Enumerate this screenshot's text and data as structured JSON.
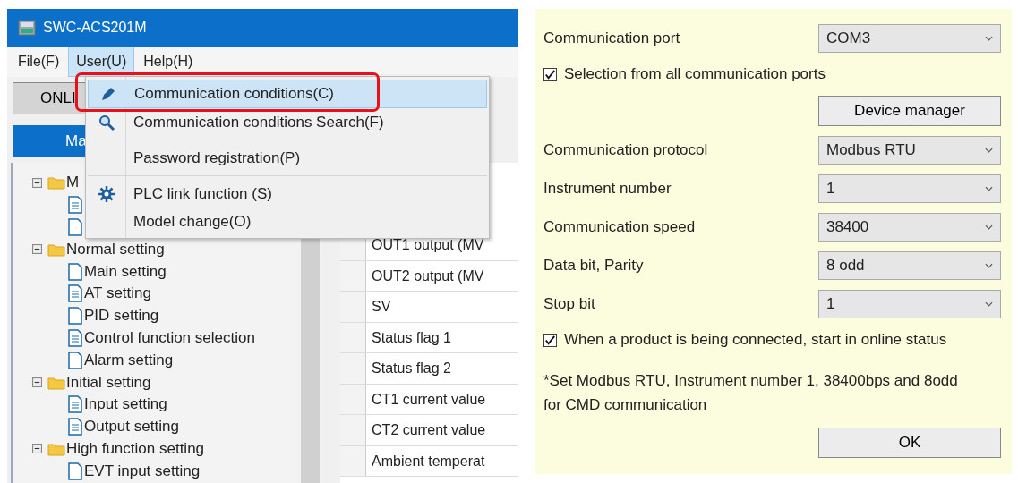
{
  "window": {
    "title": "SWC-ACS201M"
  },
  "menu_bar": [
    {
      "label": "File(F)",
      "selected": false
    },
    {
      "label": "User(U)",
      "selected": true
    },
    {
      "label": "Help(H)",
      "selected": false
    }
  ],
  "toolbar": {
    "button": "ONLI"
  },
  "tab": {
    "label": "Ma"
  },
  "tree": [
    {
      "label": "M",
      "expanded": true,
      "children": [
        {
          "kind": "lined"
        },
        {
          "kind": "plain"
        }
      ]
    },
    {
      "label": "Normal setting",
      "expanded": true,
      "children": [
        {
          "kind": "plain",
          "label": "Main setting"
        },
        {
          "kind": "lined",
          "label": "AT setting"
        },
        {
          "kind": "plain",
          "label": "PID setting"
        },
        {
          "kind": "lined",
          "label": "Control function selection"
        },
        {
          "kind": "plain",
          "label": "Alarm setting"
        }
      ]
    },
    {
      "label": "Initial setting",
      "expanded": true,
      "children": [
        {
          "kind": "lined",
          "label": "Input setting"
        },
        {
          "kind": "lined",
          "label": "Output setting"
        }
      ]
    },
    {
      "label": "High function setting",
      "expanded": true,
      "children": [
        {
          "kind": "plain",
          "label": "EVT input setting"
        }
      ]
    }
  ],
  "grid_rows": [
    "OUT1 output (MV",
    "OUT2 output (MV",
    "SV",
    "Status flag 1",
    "Status flag 2",
    "CT1 current value",
    "CT2 current value",
    "Ambient temperat"
  ],
  "user_menu": {
    "items": [
      {
        "label": "Communication conditions(C)",
        "kind": "pen",
        "selected": true,
        "annotated": true,
        "separator_before": false
      },
      {
        "label": "Communication conditions Search(F)",
        "kind": "search",
        "selected": false,
        "annotated": false,
        "separator_before": false
      },
      {
        "label": "Password registration(P)",
        "kind": "plain",
        "selected": false,
        "annotated": false,
        "separator_before": true
      },
      {
        "label": "PLC link function (S)",
        "kind": "gear",
        "selected": false,
        "annotated": false,
        "separator_before": true
      },
      {
        "label": "Model change(O)",
        "kind": "plain",
        "selected": false,
        "annotated": false,
        "separator_before": false
      }
    ]
  },
  "dialog": {
    "fields": [
      {
        "kind": "select",
        "label": "Communication port",
        "value": "COM3"
      },
      {
        "kind": "checkbox",
        "label": "Selection from all communication ports",
        "checked": true
      },
      {
        "kind": "button",
        "label": "Device manager"
      },
      {
        "kind": "select",
        "label": "Communication protocol",
        "value": "Modbus RTU"
      },
      {
        "kind": "select",
        "label": "Instrument number",
        "value": "1"
      },
      {
        "kind": "select",
        "label": "Communication speed",
        "value": "38400"
      },
      {
        "kind": "select",
        "label": "Data bit, Parity",
        "value": "8 odd"
      },
      {
        "kind": "select",
        "label": "Stop bit",
        "value": "1"
      },
      {
        "kind": "checkbox",
        "label": "When a product is being connected, start in online status",
        "checked": true
      },
      {
        "kind": "note",
        "label": "*Set Modbus RTU, Instrument number 1, 38400bps and 8odd for CMD communication"
      },
      {
        "kind": "button",
        "label": "OK"
      }
    ]
  }
}
